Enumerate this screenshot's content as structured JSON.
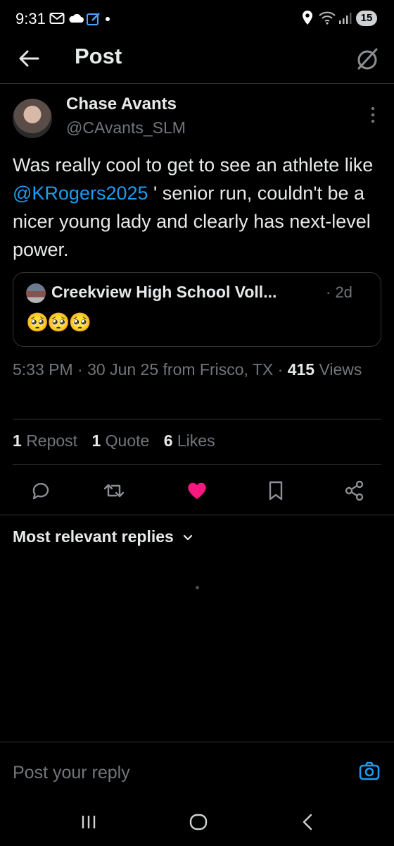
{
  "status_bar": {
    "time": "9:31",
    "battery": "15"
  },
  "header": {
    "title": "Post"
  },
  "post": {
    "author_name": "Chase Avants",
    "author_handle": "@CAvants_SLM",
    "text_before": "Was really cool to get to see an athlete like ",
    "mention": "@KRogers2025",
    "text_after": " ' senior run, couldn't be a nicer young lady and clearly has next-level power.",
    "quote": {
      "name": "Creekview High School Voll...",
      "time": "· 2d",
      "emojis": "🥺🥺🥺"
    },
    "meta": {
      "timestamp": "5:33 PM · 30 Jun 25 from Frisco, TX · ",
      "views_count": "415",
      "views_label": " Views"
    },
    "stats": {
      "reposts_count": "1",
      "reposts_label": "Repost",
      "quotes_count": "1",
      "quotes_label": "Quote",
      "likes_count": "6",
      "likes_label": "Likes"
    },
    "liked_color": "#f91880"
  },
  "replies": {
    "sort_label": "Most relevant replies",
    "reply_placeholder": "Post your reply"
  },
  "colors": {
    "accent": "#1d9bf0",
    "muted": "#71767b",
    "divider": "#2f3336"
  }
}
